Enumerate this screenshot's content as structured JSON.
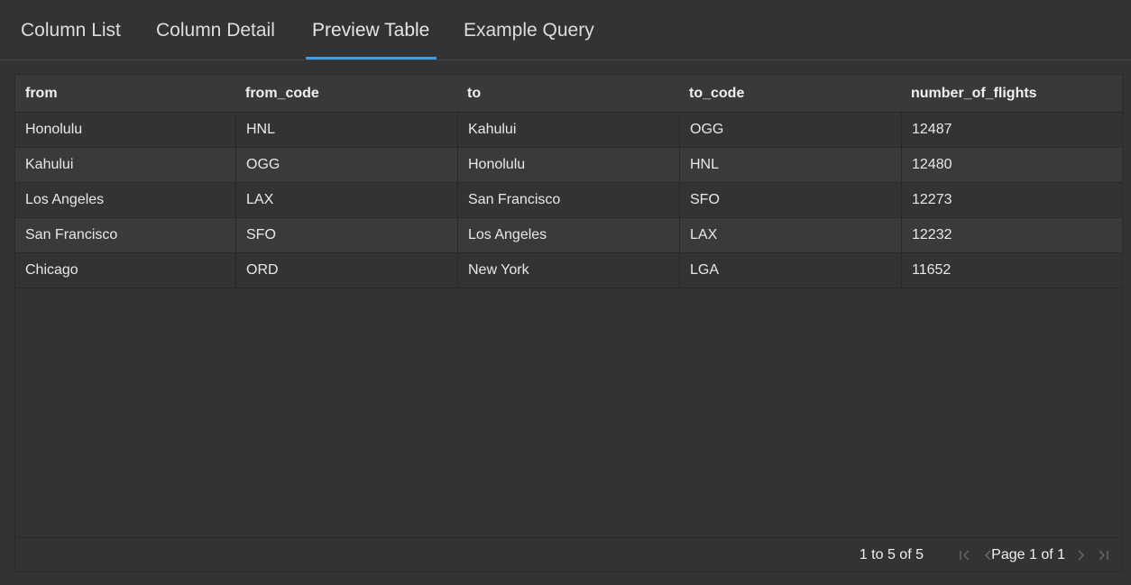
{
  "tabs": [
    {
      "label": "Column List",
      "active": false
    },
    {
      "label": "Column Detail",
      "active": false
    },
    {
      "label": "Preview Table",
      "active": true
    },
    {
      "label": "Example Query",
      "active": false
    }
  ],
  "table": {
    "columns": [
      "from",
      "from_code",
      "to",
      "to_code",
      "number_of_flights"
    ],
    "rows": [
      [
        "Honolulu",
        "HNL",
        "Kahului",
        "OGG",
        "12487"
      ],
      [
        "Kahului",
        "OGG",
        "Honolulu",
        "HNL",
        "12480"
      ],
      [
        "Los Angeles",
        "LAX",
        "San Francisco",
        "SFO",
        "12273"
      ],
      [
        "San Francisco",
        "SFO",
        "Los Angeles",
        "LAX",
        "12232"
      ],
      [
        "Chicago",
        "ORD",
        "New York",
        "LGA",
        "11652"
      ]
    ]
  },
  "pagination": {
    "summary": "1 to 5 of 5",
    "page_label": "Page 1 of 1",
    "icons": [
      "first-page-icon",
      "previous-page-icon",
      "next-page-icon",
      "last-page-icon"
    ]
  },
  "colors": {
    "accent": "#3d9ee6",
    "background": "#333333"
  }
}
